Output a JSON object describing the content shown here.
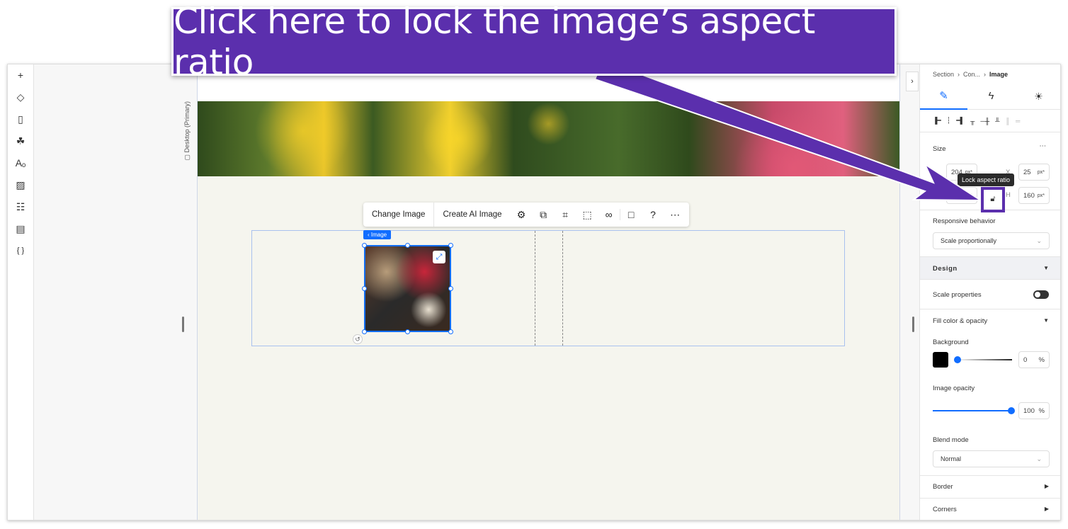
{
  "callout": {
    "text": "Click here to lock the image’s aspect ratio",
    "color": "#5b2fad"
  },
  "left_toolbar": [
    {
      "icon": "plus-icon",
      "glyph": "+"
    },
    {
      "icon": "layers-icon",
      "glyph": "◇"
    },
    {
      "icon": "page-icon",
      "glyph": "▯"
    },
    {
      "icon": "apps-icon",
      "glyph": "☘"
    },
    {
      "icon": "theme-icon",
      "glyph": "Aₒ"
    },
    {
      "icon": "media-icon",
      "glyph": "▨"
    },
    {
      "icon": "grid-icon",
      "glyph": "☷"
    },
    {
      "icon": "table-icon",
      "glyph": "▤"
    },
    {
      "icon": "code-icon",
      "glyph": "{ }"
    }
  ],
  "canvas": {
    "breakpoint_label": "▢ Desktop (Primary)",
    "image_tag": "‹ Image"
  },
  "toolbar": {
    "change_image": "Change Image",
    "create_ai_image": "Create AI Image",
    "icons": [
      {
        "icon": "settings-icon",
        "glyph": "⚙"
      },
      {
        "icon": "mask-icon",
        "glyph": "⧉"
      },
      {
        "icon": "crop-icon",
        "glyph": "⌗"
      },
      {
        "icon": "focal-point-icon",
        "glyph": "⬚"
      },
      {
        "icon": "link-icon",
        "glyph": "∞"
      },
      {
        "icon": "comment-icon",
        "glyph": "□"
      },
      {
        "icon": "help-icon",
        "glyph": "?"
      },
      {
        "icon": "more-icon",
        "glyph": "⋯"
      }
    ]
  },
  "panel": {
    "breadcrumb": [
      "Section",
      "Con...",
      "Image"
    ],
    "tabs": [
      {
        "icon": "brush-icon",
        "glyph": "✎",
        "active": true
      },
      {
        "icon": "lightning-icon",
        "glyph": "ϟ"
      },
      {
        "icon": "lightbulb-icon",
        "glyph": "☀"
      }
    ],
    "align_icons": [
      "▐━",
      "┆",
      "━▌",
      "╥",
      "─╫",
      "╨",
      "║",
      "═"
    ],
    "size": {
      "title": "Size",
      "more": "⋯",
      "w": "204",
      "x_label": "X",
      "x": "25",
      "h_label": "H",
      "h": "160",
      "unit": "px*",
      "tooltip": "Lock aspect ratio"
    },
    "responsive": {
      "label": "Responsive behavior",
      "value": "Scale proportionally"
    },
    "design": {
      "title": "Design",
      "scale_label": "Scale properties",
      "scale_on": false,
      "fill_title": "Fill color & opacity",
      "bg_label": "Background",
      "bg_color": "#000000",
      "bg_opacity": "0",
      "pct": "%",
      "img_opacity_label": "Image opacity",
      "img_opacity": "100",
      "blend_label": "Blend mode",
      "blend_value": "Normal",
      "border": "Border",
      "corners": "Corners"
    }
  }
}
